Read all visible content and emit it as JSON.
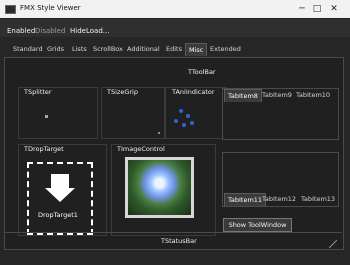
{
  "window": {
    "title": "FMX Style Viewer",
    "controls": {
      "minimize": "─",
      "maximize": "□",
      "close": "✕"
    }
  },
  "menu": {
    "items": [
      "Enabled",
      "Disabled",
      "Hide",
      "Load..."
    ]
  },
  "tabs": {
    "items": [
      "Standard",
      "Grids",
      "Lists",
      "ScrollBox",
      "Additional",
      "Edits",
      "Misc",
      "Extended"
    ],
    "active": "Misc"
  },
  "main": {
    "toolbar_label": "TToolBar",
    "groups": {
      "splitter": "TSplitter",
      "sizegrip": "TSizeGrip",
      "aniindicator": "TAniIndicator",
      "droptarget": "TDropTarget",
      "imagecontrol": "TImageControl"
    },
    "tabcontrol_top": {
      "items": [
        "TabItem8",
        "TabItem9",
        "TabItem10"
      ],
      "active": "TabItem8"
    },
    "tabcontrol_bottom": {
      "items": [
        "TabItem11",
        "TabItem12",
        "TabItem13"
      ],
      "active": "TabItem11"
    },
    "droptarget_label": "DropTarget1",
    "show_toolwindow_button": "Show ToolWindow",
    "statusbar_label": "TStatusBar"
  }
}
